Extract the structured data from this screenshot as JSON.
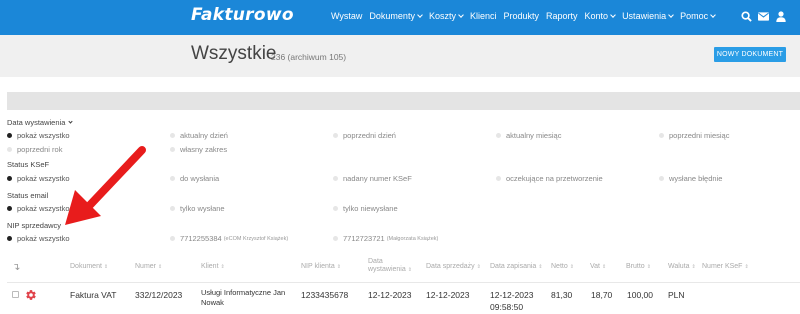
{
  "brand": "Fakturowo",
  "nav": {
    "items": [
      {
        "label": "Wystaw",
        "dropdown": false
      },
      {
        "label": "Dokumenty",
        "dropdown": true
      },
      {
        "label": "Koszty",
        "dropdown": true
      },
      {
        "label": "Klienci",
        "dropdown": false
      },
      {
        "label": "Produkty",
        "dropdown": false
      },
      {
        "label": "Raporty",
        "dropdown": false
      },
      {
        "label": "Konto",
        "dropdown": true
      },
      {
        "label": "Ustawienia",
        "dropdown": true
      },
      {
        "label": "Pomoc",
        "dropdown": true
      }
    ],
    "icons": [
      "search-icon",
      "envelope-icon",
      "user-icon"
    ]
  },
  "header": {
    "title": "Wszystkie",
    "count": "236 (archiwum 105)",
    "new_button": "NOWY DOKUMENT"
  },
  "filters": {
    "date": {
      "title": "Data wystawienia",
      "options": [
        "pokaż wszystko",
        "aktualny dzień",
        "poprzedni dzień",
        "aktualny miesiąc",
        "poprzedni miesiąc",
        "poprzedni rok",
        "własny zakres"
      ],
      "selected": 0
    },
    "ksef": {
      "title": "Status KSeF",
      "options": [
        "pokaż wszystko",
        "do wysłania",
        "nadany numer KSeF",
        "oczekujące na przetworzenie",
        "wysłane błędnie"
      ],
      "selected": 0
    },
    "email": {
      "title": "Status email",
      "options": [
        "pokaż wszystko",
        "tylko wysłane",
        "tylko niewysłane"
      ],
      "selected": 0
    },
    "nip": {
      "title": "NIP sprzedawcy",
      "options": [
        {
          "label": "pokaż wszystko",
          "note": ""
        },
        {
          "label": "7712255384",
          "note": "(eCOM Krzysztof Książek)"
        },
        {
          "label": "7712723721",
          "note": "(Małgorzata Książek)"
        }
      ],
      "selected": 0
    }
  },
  "table": {
    "headers": [
      "Dokument",
      "Numer",
      "Klient",
      "NIP klienta",
      "Data wystawienia",
      "Data sprzedaży",
      "Data zapisania",
      "Netto",
      "Vat",
      "Brutto",
      "Waluta",
      "Numer KSeF"
    ],
    "rows": [
      {
        "dokument": "Faktura VAT",
        "numer": "332/12/2023",
        "klient_line1": "Usługi Informatyczne Jan",
        "klient_line2": "Nowak",
        "nip": "1233435678",
        "data_wystawienia": "12-12-2023",
        "data_sprzedazy": "12-12-2023",
        "data_zapisania": "12-12-2023",
        "czas_zapisania": "09:58:50",
        "netto": "81,30",
        "vat": "18,70",
        "brutto": "100,00",
        "waluta": "PLN",
        "ksef": ""
      }
    ]
  },
  "colors": {
    "nav_bg": "#1b87d8",
    "button_bg": "#2a9de6",
    "header_bg": "#f0f0f0",
    "arrow": "#e81c1c",
    "gear": "#e0424a"
  }
}
